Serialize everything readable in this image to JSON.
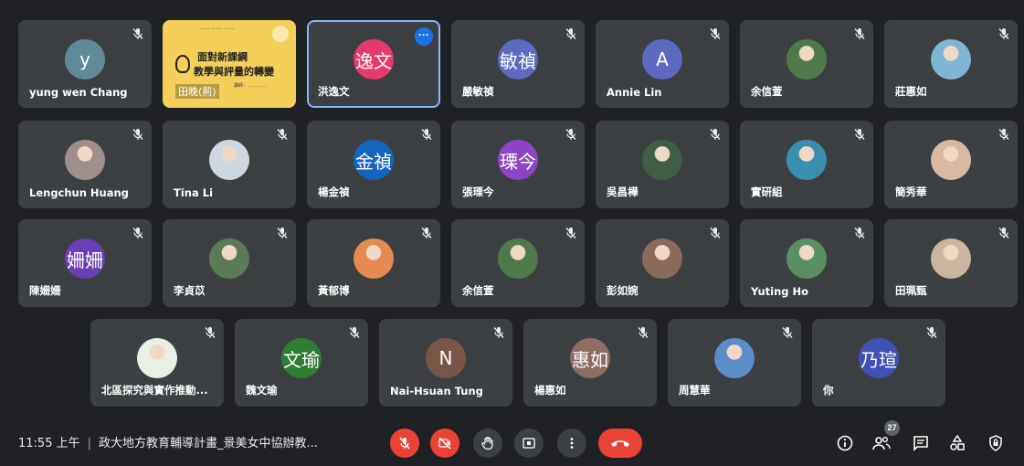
{
  "participants": [
    {
      "name": "yung wen Chang",
      "avatar_text": "y",
      "avatar_color": "#5f8b97",
      "type": "letter"
    },
    {
      "name": "",
      "type": "presentation",
      "slide": {
        "line0": "…… …… ……",
        "line1": "面對新課綱",
        "line2": "教學與評量的轉變",
        "line3": "講師：…… ……",
        "tagline": "田晚(荊)"
      }
    },
    {
      "name": "洪逸文",
      "avatar_text": "逸文",
      "avatar_color": "#e8396e",
      "type": "letter",
      "active": true
    },
    {
      "name": "嚴敏禎",
      "avatar_text": "敏禎",
      "avatar_color": "#5c6bc0",
      "type": "letter"
    },
    {
      "name": "Annie Lin",
      "avatar_text": "A",
      "avatar_color": "#5c6bc0",
      "type": "letter"
    },
    {
      "name": "余信萱",
      "type": "photo",
      "photo_color": "#4e7a4a"
    },
    {
      "name": "莊惠如",
      "type": "photo",
      "photo_color": "#7fb6d6"
    },
    {
      "name": "Lengchun Huang",
      "type": "photo",
      "photo_color": "#9e8f8a"
    },
    {
      "name": "Tina Li",
      "type": "photo",
      "photo_color": "#cfd8e0"
    },
    {
      "name": "楊金禎",
      "avatar_text": "金禎",
      "avatar_color": "#1565c0",
      "type": "letter"
    },
    {
      "name": "張瑮今",
      "avatar_text": "瑮今",
      "avatar_color": "#8e44c4",
      "type": "letter"
    },
    {
      "name": "吳昌樺",
      "type": "photo",
      "photo_color": "#3f5e45"
    },
    {
      "name": "實研組",
      "type": "photo",
      "photo_color": "#3a8fb0"
    },
    {
      "name": "簡秀華",
      "type": "photo",
      "photo_color": "#d9b8a0"
    },
    {
      "name": "陳姍姍",
      "avatar_text": "姍姍",
      "avatar_color": "#6a3fb5",
      "type": "letter"
    },
    {
      "name": "李貞苡",
      "type": "photo",
      "photo_color": "#5b7a55"
    },
    {
      "name": "黃郁博",
      "type": "photo",
      "photo_color": "#e58a50"
    },
    {
      "name": "余信萱",
      "type": "photo",
      "photo_color": "#4e7a4a"
    },
    {
      "name": "彭如婉",
      "type": "photo",
      "photo_color": "#8a6a5a"
    },
    {
      "name": "Yuting Ho",
      "type": "photo",
      "photo_color": "#5a8f63"
    },
    {
      "name": "田珮甄",
      "type": "photo",
      "photo_color": "#c8b79e"
    },
    {
      "name": "北區探究與實作推動...",
      "type": "photo",
      "photo_color": "#e8f0e6"
    },
    {
      "name": "魏文瑜",
      "avatar_text": "文瑜",
      "avatar_color": "#2e7d32",
      "type": "letter"
    },
    {
      "name": "Nai-Hsuan Tung",
      "avatar_text": "N",
      "avatar_color": "#795548",
      "type": "letter"
    },
    {
      "name": "楊惠如",
      "avatar_text": "惠如",
      "avatar_color": "#8d6e63",
      "type": "letter"
    },
    {
      "name": "周慧華",
      "type": "photo",
      "photo_color": "#5b8dc8"
    },
    {
      "name": "你",
      "avatar_text": "乃瑄",
      "avatar_color": "#3f51b5",
      "type": "letter"
    }
  ],
  "bottom_bar": {
    "time": "11:55 上午",
    "separator": "|",
    "meeting_title": "政大地方教育輔導計畫_景美女中協辦教...",
    "participant_count": "27"
  },
  "colors": {
    "background": "#202124",
    "tile": "#3c4043",
    "red": "#ea4335",
    "accent": "#1a73e8"
  }
}
